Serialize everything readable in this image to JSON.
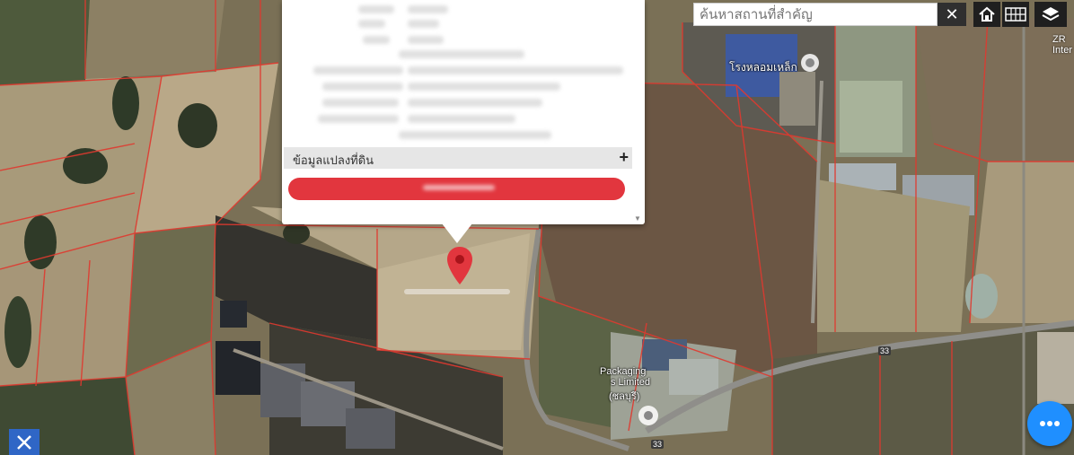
{
  "search": {
    "placeholder": "ค้นหาสถานที่สำคัญ",
    "clear_label": "✕"
  },
  "toolbar": {
    "home_icon": "home-icon",
    "grid_icon": "grid-icon",
    "layers_icon": "layers-icon"
  },
  "map": {
    "corner_label": "ZR Inter",
    "poi_top": "โรงหลอมเหล็ก",
    "poi_bottom_lines": [
      "Packaging",
      "s Limited",
      "(ชลบุรี)"
    ]
  },
  "popup": {
    "info_label": "ข้อมูลแปลงที่ดิน",
    "expand_label": "+",
    "scroll_label": "▼"
  },
  "colors": {
    "accent_red": "#e2363e",
    "fab_blue": "#1f8fff",
    "parcel_line": "#e0392f"
  }
}
